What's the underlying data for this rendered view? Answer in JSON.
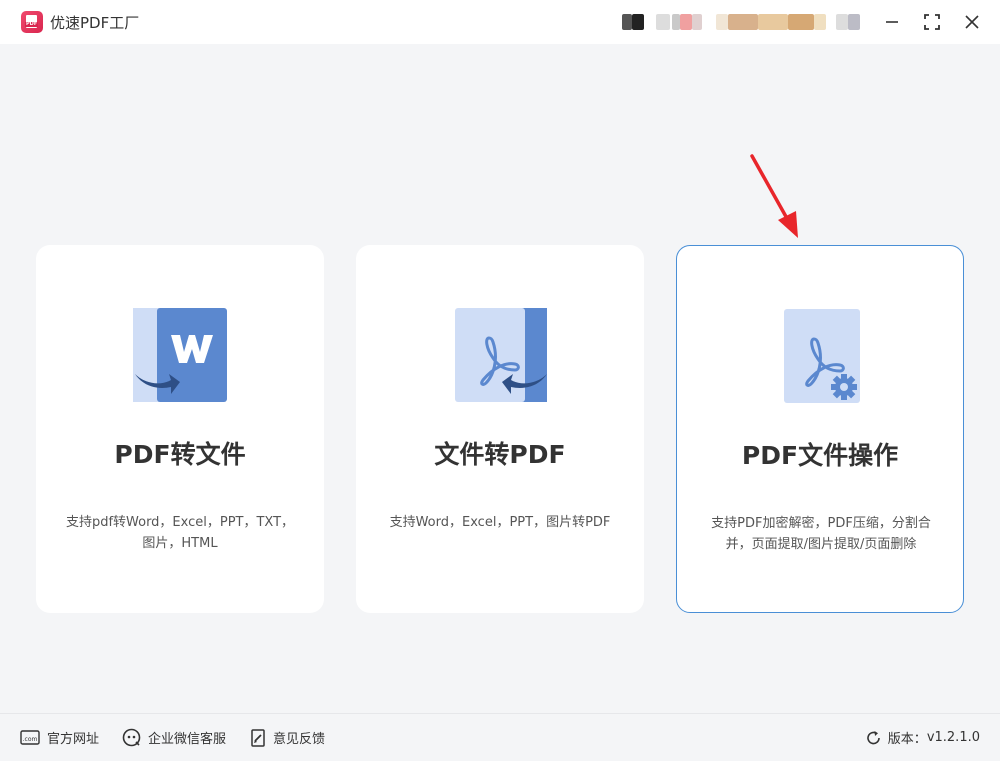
{
  "app": {
    "title": "优速PDF工厂",
    "logo_text": "PDF"
  },
  "colors": {
    "accent_border": "#4a8fd6",
    "doc_light": "#cfddf6",
    "doc_dark": "#5b88cf",
    "annotation_arrow": "#e8262b"
  },
  "cards": [
    {
      "title": "PDF转文件",
      "desc_line1": "支持pdf转Word，Excel，PPT，TXT，",
      "desc_line2": "图片，HTML"
    },
    {
      "title": "文件转PDF",
      "desc_line1": "支持Word，Excel，PPT，图片转PDF",
      "desc_line2": ""
    },
    {
      "title": "PDF文件操作",
      "desc_line1": "支持PDF加密解密，PDF压缩，分割合",
      "desc_line2": "并，页面提取/图片提取/页面删除"
    }
  ],
  "footer": {
    "website": "官方网址",
    "wechat": "企业微信客服",
    "feedback": "意见反馈",
    "version_label": "版本：",
    "version": "v1.2.1.0"
  }
}
